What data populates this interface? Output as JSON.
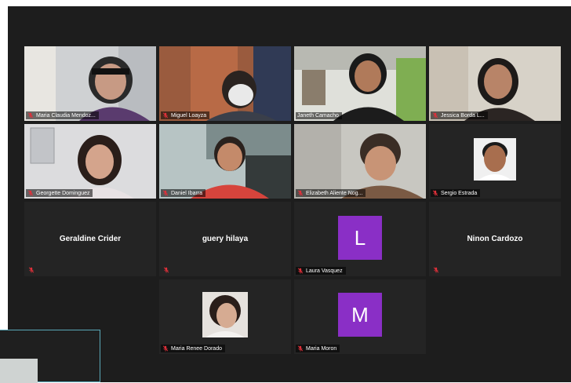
{
  "participants": [
    {
      "name": "Maria Claudia Mendoz...",
      "muted": true
    },
    {
      "name": "Miguel Loayza",
      "muted": true
    },
    {
      "name": "Janeth Camacho",
      "muted": false,
      "active_speaker": true
    },
    {
      "name": "Jessica Borda L...",
      "muted": true
    },
    {
      "name": "Georgette Dominguez",
      "muted": true
    },
    {
      "name": "Daniel Ibarra",
      "muted": true
    },
    {
      "name": "Elizabeth Aliente Nog...",
      "muted": true
    },
    {
      "name": "Sergio Estrada",
      "muted": true
    },
    {
      "name": "Geraldine Crider",
      "muted": true
    },
    {
      "name": "guery hilaya",
      "muted": true
    },
    {
      "name": "Laura Vasquez",
      "muted": true,
      "avatar_letter": "L"
    },
    {
      "name": "Ninon Cardozo",
      "muted": true
    },
    {
      "name": "Maria Renee Dorado",
      "muted": true
    },
    {
      "name": "Maria Moron",
      "muted": true,
      "avatar_letter": "M"
    }
  ],
  "colors": {
    "background": "#1d1d1d",
    "tile": "#242424",
    "active_outline": "#c8e65a",
    "avatar": "#8a2fc6",
    "muted_icon": "#e0303a"
  }
}
